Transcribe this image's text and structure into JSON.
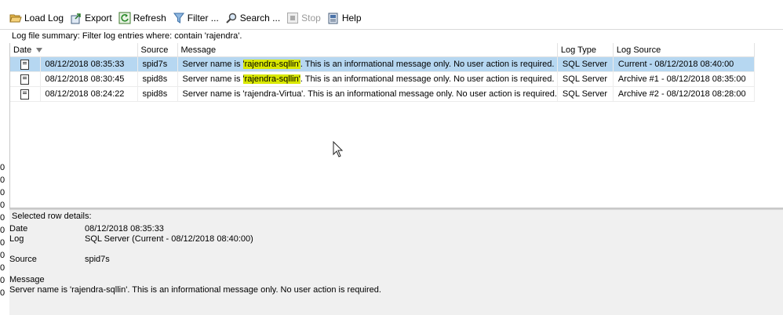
{
  "toolbar": {
    "load_log": "Load Log",
    "export": "Export",
    "refresh": "Refresh",
    "filter": "Filter ...",
    "search": "Search ...",
    "stop": "Stop",
    "help": "Help"
  },
  "summary": "Log file summary: Filter log entries where: contain 'rajendra'.",
  "columns": {
    "date": "Date",
    "source": "Source",
    "message": "Message",
    "log_type": "Log Type",
    "log_source": "Log Source"
  },
  "rows": [
    {
      "date": "08/12/2018 08:35:33",
      "source": "spid7s",
      "msg_pre": "Server name is ",
      "msg_hl": "'rajendra-sqllin'",
      "msg_post": ". This is an informational message only. No user action is required.",
      "log_type": "SQL Server",
      "log_source": "Current - 08/12/2018 08:40:00",
      "selected": true
    },
    {
      "date": "08/12/2018 08:30:45",
      "source": "spid8s",
      "msg_pre": "Server name is ",
      "msg_hl": "'rajendra-sqllin'",
      "msg_post": ". This is an informational message only. No user action is required.",
      "log_type": "SQL Server",
      "log_source": "Archive #1 - 08/12/2018 08:35:00",
      "selected": false
    },
    {
      "date": "08/12/2018 08:24:22",
      "source": "spid8s",
      "msg_pre": "Server name is 'rajendra-Virtua'. This is an informational message only. No user action is required.",
      "msg_hl": "",
      "msg_post": "",
      "log_type": "SQL Server",
      "log_source": "Archive #2 - 08/12/2018 08:28:00",
      "selected": false
    }
  ],
  "details": {
    "heading": "Selected row details:",
    "date_label": "Date",
    "date_value": "08/12/2018 08:35:33",
    "log_label": "Log",
    "log_value": "SQL Server (Current - 08/12/2018 08:40:00)",
    "source_label": "Source",
    "source_value": "spid7s",
    "message_label": "Message",
    "message_value": "Server name is 'rajendra-sqllin'. This is an informational message only. No user action is required."
  },
  "left_strip_digits": [
    "0",
    "0",
    "0",
    "0",
    "0",
    "0",
    "0",
    "0",
    "0",
    "0",
    "0"
  ],
  "colors": {
    "selected_row": "#b6d7f1",
    "highlight": "#d9e800",
    "details_bg": "#f0f0f0"
  },
  "icons": [
    "folder-open-icon",
    "export-icon",
    "refresh-icon",
    "filter-icon",
    "search-icon",
    "stop-icon",
    "help-book-icon",
    "log-entry-icon",
    "sort-desc-icon",
    "mouse-cursor-icon"
  ]
}
